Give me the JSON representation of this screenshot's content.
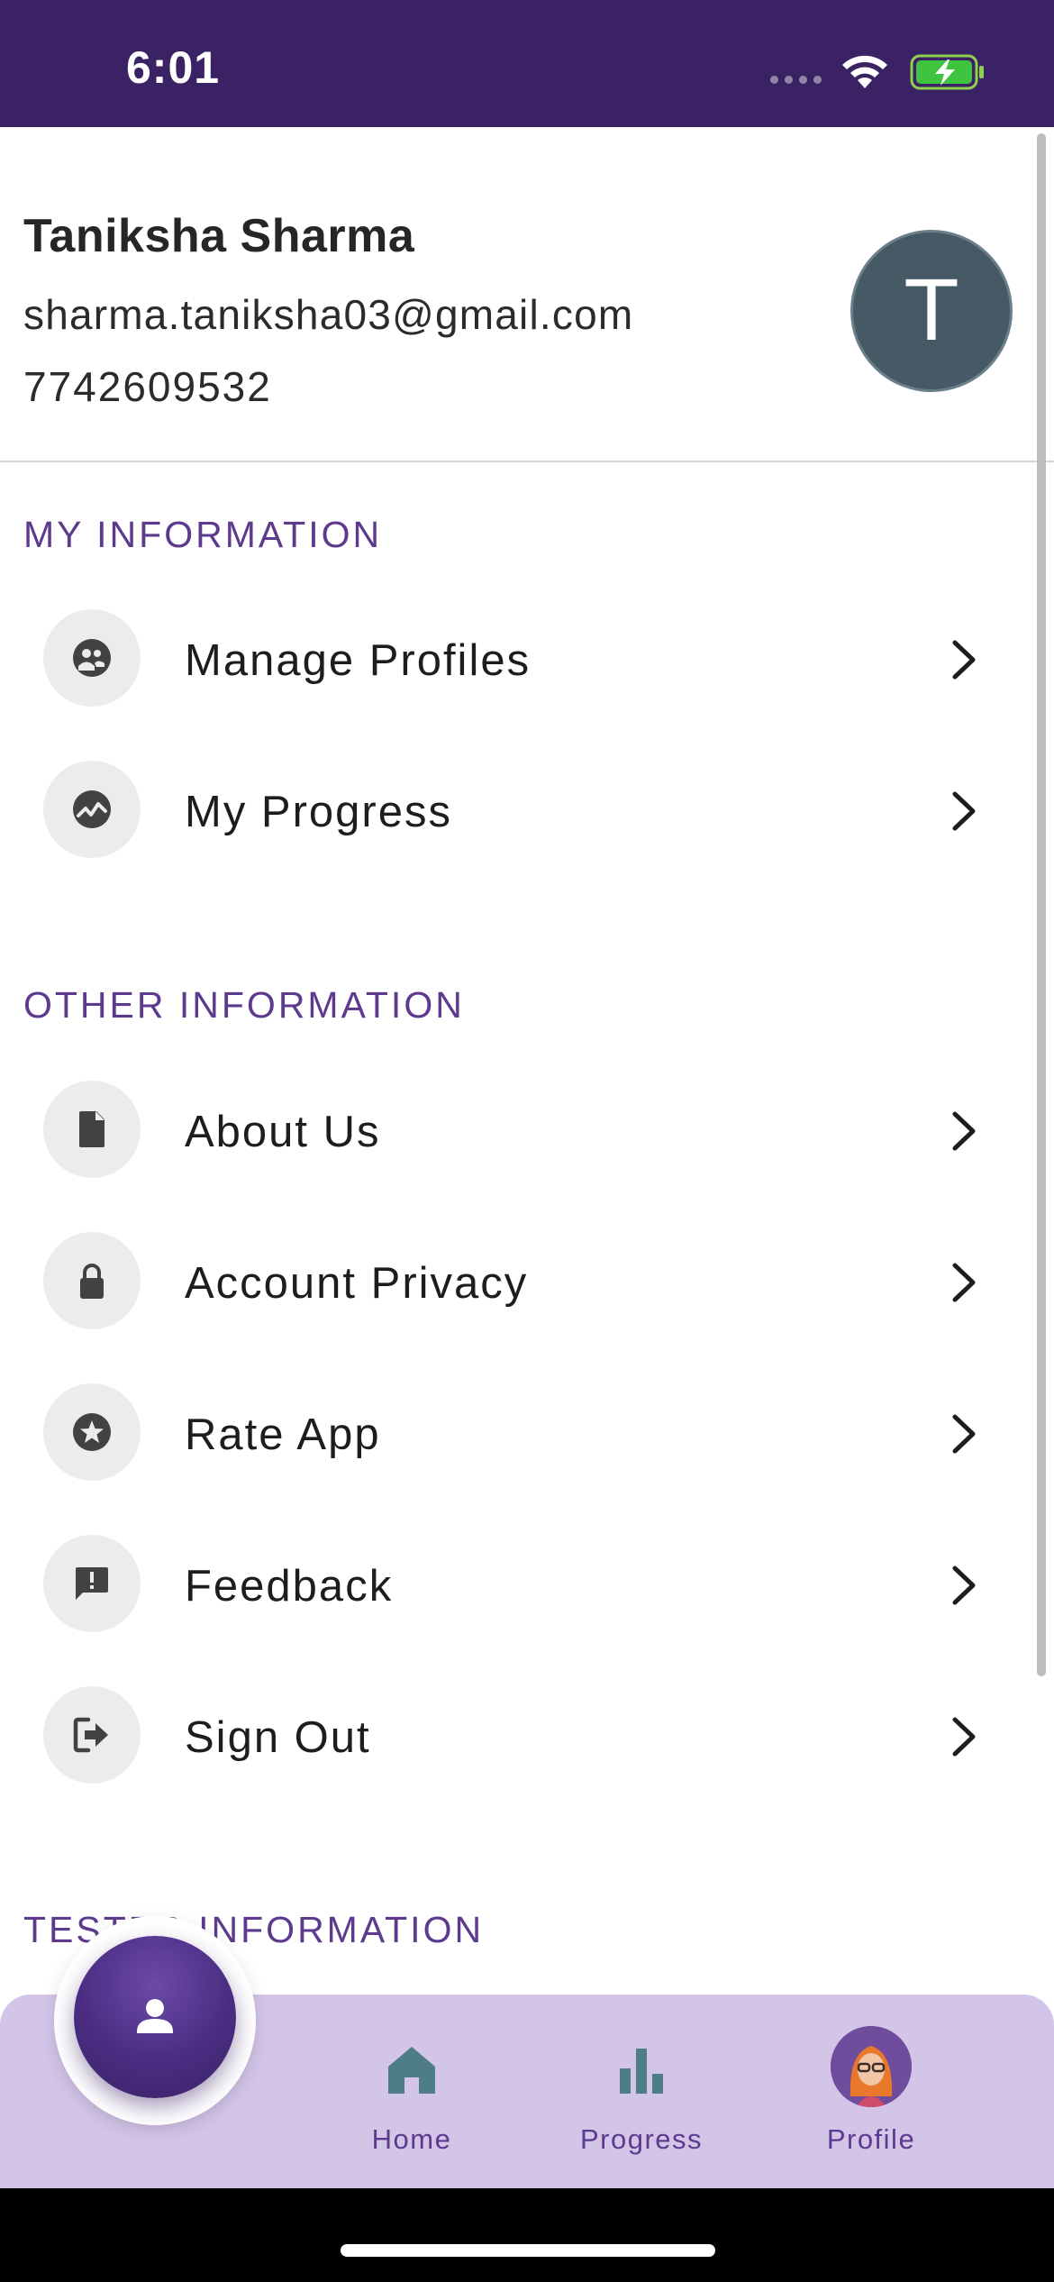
{
  "status_bar": {
    "time": "6:01"
  },
  "profile": {
    "name": "Taniksha Sharma",
    "email": "sharma.taniksha03@gmail.com",
    "phone": "7742609532",
    "avatar_initial": "T"
  },
  "sections": {
    "my_information": "MY INFORMATION",
    "other_information": "OTHER INFORMATION",
    "tester_information": "TESTER INFORMATION"
  },
  "menu": {
    "manage_profiles": "Manage Profiles",
    "my_progress": "My Progress",
    "about_us": "About Us",
    "account_privacy": "Account Privacy",
    "rate_app": "Rate App",
    "feedback": "Feedback",
    "sign_out": "Sign Out"
  },
  "bottom_nav": {
    "home": "Home",
    "progress": "Progress",
    "profile": "Profile"
  },
  "icons": {
    "manage_profiles": "group-icon",
    "my_progress": "trend-icon",
    "about_us": "document-icon",
    "account_privacy": "lock-icon",
    "rate_app": "star-icon",
    "feedback": "feedback-icon",
    "sign_out": "sign-out-icon",
    "fab": "person-icon"
  },
  "colors": {
    "status_bar": "#3a2265",
    "section_title": "#5d3a8e",
    "avatar": "#455a64",
    "bottom_nav": "#d3c5e8"
  }
}
